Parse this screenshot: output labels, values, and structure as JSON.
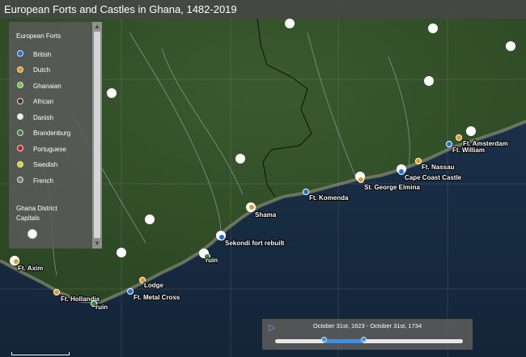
{
  "title": "European Forts and Castles in Ghana, 1482-2019",
  "legend": {
    "forts_heading": "European Forts",
    "items": [
      {
        "label": "British",
        "color": "#1f6fd6"
      },
      {
        "label": "Dutch",
        "color": "#e69a1c"
      },
      {
        "label": "Ghanaian",
        "color": "#5fd13a"
      },
      {
        "label": "African",
        "color": "#5a3314"
      },
      {
        "label": "Danish",
        "color": "#f2f2f2"
      },
      {
        "label": "Brandenburg",
        "color": "#2f8b2f"
      },
      {
        "label": "Portuguese",
        "color": "#c41d1d"
      },
      {
        "label": "Swedish",
        "color": "#e5d61a"
      },
      {
        "label": "French",
        "color": "#7a7a7a"
      }
    ],
    "capitals_heading_line1": "Ghana District",
    "capitals_heading_line2": "Capitals"
  },
  "sites": [
    {
      "label": "Ft. Amsterdam",
      "color": "#e69a1c"
    },
    {
      "label": "Ft. William",
      "color": "#1f6fd6"
    },
    {
      "label": "Ft. Nassau",
      "color": "#e69a1c"
    },
    {
      "label": "Cape Coast Castle",
      "color": "#1f6fd6"
    },
    {
      "label": "St. George Elmina",
      "color": "#e69a1c"
    },
    {
      "label": "Ft. Komenda",
      "color": "#1f6fd6"
    },
    {
      "label": "Shama",
      "color": "#e69a1c"
    },
    {
      "label": "Sekondi fort rebuilt",
      "color": "#1f6fd6"
    },
    {
      "label": "ruin",
      "color": "#2f8b2f"
    },
    {
      "label": "Lodge",
      "color": "#e69a1c"
    },
    {
      "label": "Ft. Metal Cross",
      "color": "#1f6fd6"
    },
    {
      "label": "Ft. Hollandia",
      "color": "#e69a1c"
    },
    {
      "label": "ruin",
      "color": "#2f8b2f"
    },
    {
      "label": "Ft. Axim",
      "color": "#e69a1c"
    }
  ],
  "timeline": {
    "range_label": "October 31st, 1623 - October 31st, 1734",
    "start_fraction": 0.26,
    "end_fraction": 0.47
  }
}
